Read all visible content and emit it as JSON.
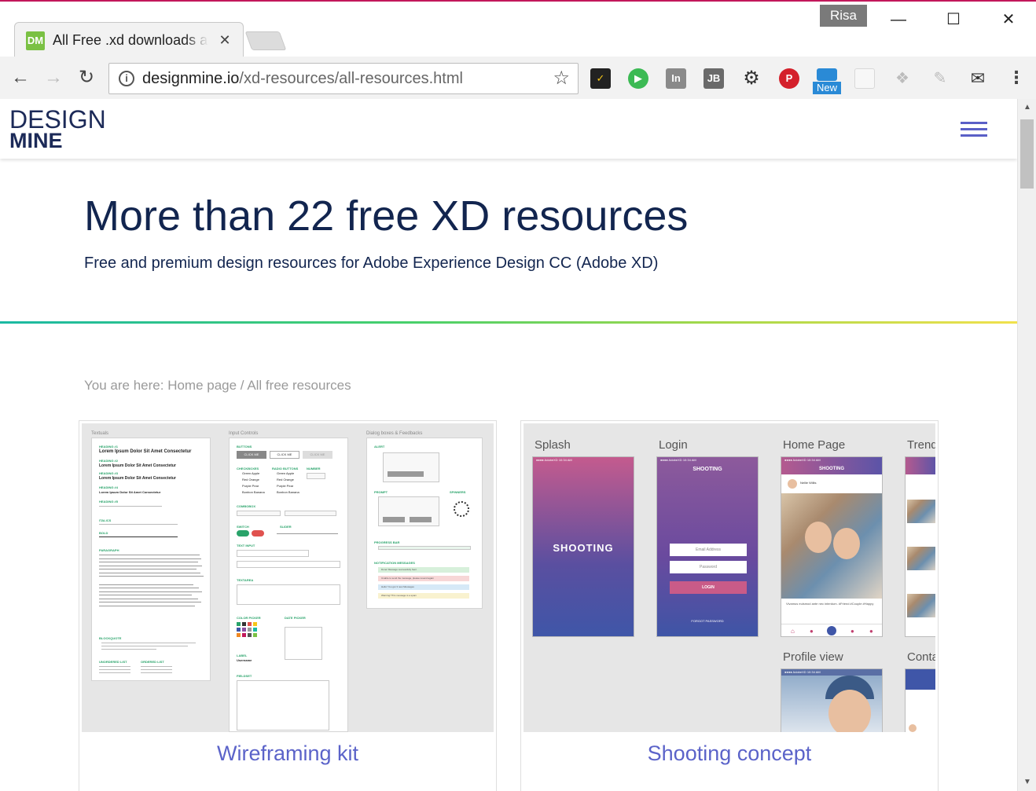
{
  "browser": {
    "tab_title": "All Free .xd downloads and resources",
    "tab_favicon_text": "DM",
    "tab_close": "✕",
    "profile_name": "Risa",
    "url_host": "designmine.io",
    "url_path": "/xd-resources/all-resources.html",
    "info_glyph": "i",
    "window_controls": {
      "minimize": "—",
      "maximize": "☐",
      "close": "✕"
    },
    "nav": {
      "back": "←",
      "forward": "→",
      "reload": "↻"
    },
    "bookmark_glyph": "☆",
    "menu_glyph": "⋮",
    "extensions": [
      {
        "name": "norton-icon",
        "label": "✓",
        "color": "#222222"
      },
      {
        "name": "play-icon",
        "label": "▶",
        "color": "#3cba54"
      },
      {
        "name": "invision-icon",
        "label": "In",
        "color": "#8a8a8a"
      },
      {
        "name": "jetbrains-icon",
        "label": "JB",
        "color": "#6a6a6a"
      },
      {
        "name": "gear-icon",
        "label": "⚙",
        "color": "#333333"
      },
      {
        "name": "pinterest-icon",
        "label": "P",
        "color": "#d4202b"
      },
      {
        "name": "new-tab-extension-icon",
        "label": "",
        "color": "#2a8ad6"
      },
      {
        "name": "page-icon",
        "label": "",
        "color": "#d8d8d8"
      },
      {
        "name": "dropbox-icon",
        "label": "❖",
        "color": "#bcbcbc"
      },
      {
        "name": "clipper-icon",
        "label": "✎",
        "color": "#bcbcbc"
      },
      {
        "name": "mail-icon",
        "label": "✉",
        "color": "#333333"
      }
    ],
    "extension_badge": "New"
  },
  "site": {
    "logo_top": "DESIGN",
    "logo_bottom": "MINE",
    "colors": {
      "navy": "#12254f",
      "accent": "#5b63c9",
      "gradient_start": "#1bb9a3",
      "gradient_end": "#f1e14c"
    }
  },
  "hero": {
    "title": "More than 22 free XD resources",
    "subtitle": "Free and premium design resources for Adobe Experience Design CC (Adobe XD)"
  },
  "breadcrumb": {
    "prefix": "You are here: ",
    "home": "Home page",
    "separator": " / ",
    "current": "All free resources"
  },
  "cards": [
    {
      "title": "Wireframing kit",
      "sections": [
        "Textuals",
        "Input Controls",
        "Dialog boxes & Feedbacks"
      ],
      "headings": [
        "Lorem Ipsum Dolor Sit Amet Consectetur",
        "Lorem Ipsum Dolor Sit Amet Consectetur",
        "Lorem Ipsum Dolor Sit Amet Consectetur",
        "Lorem Ipsum Dolor Sit Amet Consectetur"
      ],
      "buttons": [
        "CLICK ME",
        "CLICK ME",
        "CLICK ME"
      ],
      "options": [
        "Green Apple",
        "Red Orange",
        "Purple Pear",
        "Bonbon Banana"
      ],
      "notifications": [
        "Done! Message successfully Sent",
        "Unable to send the message, please resend again",
        "Hello! You got 3 new Messages",
        "Warning! This message is a spam"
      ]
    },
    {
      "title": "Shooting concept",
      "screens": [
        "Splash",
        "Login",
        "Home Page",
        "Trend",
        "Profile view",
        "Conta"
      ],
      "splash_title": "SHOOTING",
      "login_title": "SHOOTING",
      "login_email": "Email Address",
      "login_password": "Password",
      "login_button": "LOGIN",
      "login_forgot": "FORGOT PASSWORD",
      "home_title": "SHOOTING",
      "home_user": "Nellie Willis",
      "home_caption": "Vivamus euismod ante nec interdum. #Friend #Couple #Happy",
      "status_carrier": "●●●● AdobeXD",
      "status_time": "10:34 AM",
      "status_battery": "100%"
    }
  ]
}
